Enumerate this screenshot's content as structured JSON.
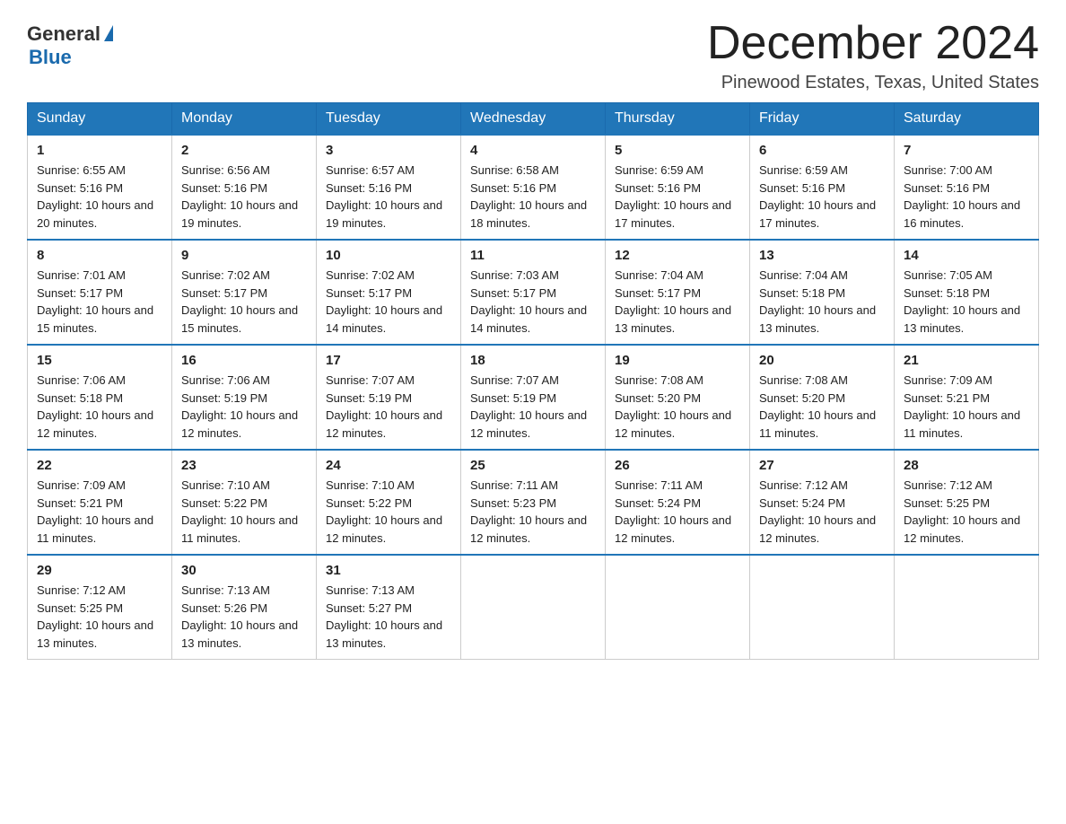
{
  "logo": {
    "general": "General",
    "blue": "Blue"
  },
  "header": {
    "month_year": "December 2024",
    "location": "Pinewood Estates, Texas, United States"
  },
  "days_of_week": [
    "Sunday",
    "Monday",
    "Tuesday",
    "Wednesday",
    "Thursday",
    "Friday",
    "Saturday"
  ],
  "weeks": [
    [
      {
        "day": "1",
        "sunrise": "6:55 AM",
        "sunset": "5:16 PM",
        "daylight": "10 hours and 20 minutes."
      },
      {
        "day": "2",
        "sunrise": "6:56 AM",
        "sunset": "5:16 PM",
        "daylight": "10 hours and 19 minutes."
      },
      {
        "day": "3",
        "sunrise": "6:57 AM",
        "sunset": "5:16 PM",
        "daylight": "10 hours and 19 minutes."
      },
      {
        "day": "4",
        "sunrise": "6:58 AM",
        "sunset": "5:16 PM",
        "daylight": "10 hours and 18 minutes."
      },
      {
        "day": "5",
        "sunrise": "6:59 AM",
        "sunset": "5:16 PM",
        "daylight": "10 hours and 17 minutes."
      },
      {
        "day": "6",
        "sunrise": "6:59 AM",
        "sunset": "5:16 PM",
        "daylight": "10 hours and 17 minutes."
      },
      {
        "day": "7",
        "sunrise": "7:00 AM",
        "sunset": "5:16 PM",
        "daylight": "10 hours and 16 minutes."
      }
    ],
    [
      {
        "day": "8",
        "sunrise": "7:01 AM",
        "sunset": "5:17 PM",
        "daylight": "10 hours and 15 minutes."
      },
      {
        "day": "9",
        "sunrise": "7:02 AM",
        "sunset": "5:17 PM",
        "daylight": "10 hours and 15 minutes."
      },
      {
        "day": "10",
        "sunrise": "7:02 AM",
        "sunset": "5:17 PM",
        "daylight": "10 hours and 14 minutes."
      },
      {
        "day": "11",
        "sunrise": "7:03 AM",
        "sunset": "5:17 PM",
        "daylight": "10 hours and 14 minutes."
      },
      {
        "day": "12",
        "sunrise": "7:04 AM",
        "sunset": "5:17 PM",
        "daylight": "10 hours and 13 minutes."
      },
      {
        "day": "13",
        "sunrise": "7:04 AM",
        "sunset": "5:18 PM",
        "daylight": "10 hours and 13 minutes."
      },
      {
        "day": "14",
        "sunrise": "7:05 AM",
        "sunset": "5:18 PM",
        "daylight": "10 hours and 13 minutes."
      }
    ],
    [
      {
        "day": "15",
        "sunrise": "7:06 AM",
        "sunset": "5:18 PM",
        "daylight": "10 hours and 12 minutes."
      },
      {
        "day": "16",
        "sunrise": "7:06 AM",
        "sunset": "5:19 PM",
        "daylight": "10 hours and 12 minutes."
      },
      {
        "day": "17",
        "sunrise": "7:07 AM",
        "sunset": "5:19 PM",
        "daylight": "10 hours and 12 minutes."
      },
      {
        "day": "18",
        "sunrise": "7:07 AM",
        "sunset": "5:19 PM",
        "daylight": "10 hours and 12 minutes."
      },
      {
        "day": "19",
        "sunrise": "7:08 AM",
        "sunset": "5:20 PM",
        "daylight": "10 hours and 12 minutes."
      },
      {
        "day": "20",
        "sunrise": "7:08 AM",
        "sunset": "5:20 PM",
        "daylight": "10 hours and 11 minutes."
      },
      {
        "day": "21",
        "sunrise": "7:09 AM",
        "sunset": "5:21 PM",
        "daylight": "10 hours and 11 minutes."
      }
    ],
    [
      {
        "day": "22",
        "sunrise": "7:09 AM",
        "sunset": "5:21 PM",
        "daylight": "10 hours and 11 minutes."
      },
      {
        "day": "23",
        "sunrise": "7:10 AM",
        "sunset": "5:22 PM",
        "daylight": "10 hours and 11 minutes."
      },
      {
        "day": "24",
        "sunrise": "7:10 AM",
        "sunset": "5:22 PM",
        "daylight": "10 hours and 12 minutes."
      },
      {
        "day": "25",
        "sunrise": "7:11 AM",
        "sunset": "5:23 PM",
        "daylight": "10 hours and 12 minutes."
      },
      {
        "day": "26",
        "sunrise": "7:11 AM",
        "sunset": "5:24 PM",
        "daylight": "10 hours and 12 minutes."
      },
      {
        "day": "27",
        "sunrise": "7:12 AM",
        "sunset": "5:24 PM",
        "daylight": "10 hours and 12 minutes."
      },
      {
        "day": "28",
        "sunrise": "7:12 AM",
        "sunset": "5:25 PM",
        "daylight": "10 hours and 12 minutes."
      }
    ],
    [
      {
        "day": "29",
        "sunrise": "7:12 AM",
        "sunset": "5:25 PM",
        "daylight": "10 hours and 13 minutes."
      },
      {
        "day": "30",
        "sunrise": "7:13 AM",
        "sunset": "5:26 PM",
        "daylight": "10 hours and 13 minutes."
      },
      {
        "day": "31",
        "sunrise": "7:13 AM",
        "sunset": "5:27 PM",
        "daylight": "10 hours and 13 minutes."
      },
      null,
      null,
      null,
      null
    ]
  ],
  "labels": {
    "sunrise": "Sunrise:",
    "sunset": "Sunset:",
    "daylight": "Daylight:"
  }
}
